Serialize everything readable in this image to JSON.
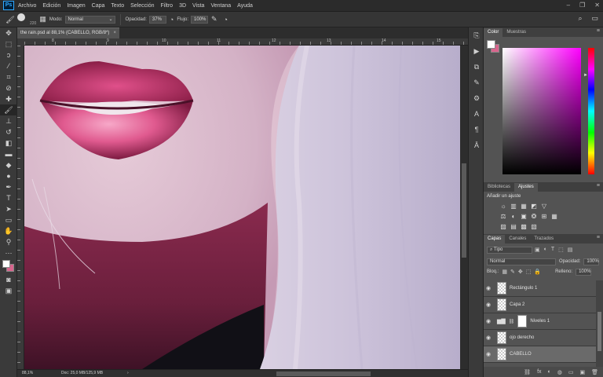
{
  "app": {
    "logo": "Ps"
  },
  "menu": [
    "Archivo",
    "Edición",
    "Imagen",
    "Capa",
    "Texto",
    "Selección",
    "Filtro",
    "3D",
    "Vista",
    "Ventana",
    "Ayuda"
  ],
  "window_controls": [
    "–",
    "❐",
    "✕"
  ],
  "options_bar": {
    "brush_size": "220",
    "mode_label": "Modo:",
    "mode_value": "Normal",
    "opacity_label": "Opacidad:",
    "opacity_value": "37%",
    "flow_label": "Flujo:",
    "flow_value": "100%"
  },
  "document_tab": {
    "title": "the rain.psd al 88,1% (CABELLO, RGB/8*)",
    "close": "×"
  },
  "ruler_labels": [
    "8",
    "9",
    "10",
    "11",
    "12",
    "13",
    "14",
    "15"
  ],
  "status": {
    "zoom": "88,1%",
    "doc": "Doc: 25,0 MB/125,9 MB"
  },
  "color_panel": {
    "tabs": [
      "Color",
      "Muestras"
    ],
    "fg_color": "#ffffff",
    "bg_color": "#d8658d",
    "hue_color": "#ff00ff"
  },
  "adjustments_panel": {
    "tabs": [
      "Bibliotecas",
      "Ajustes"
    ],
    "title": "Añadir un ajuste",
    "row1": [
      "☼",
      "▥",
      "▦",
      "◩",
      "▽"
    ],
    "row2": [
      "⚖",
      "◐",
      "▣",
      "❂",
      "⊞",
      "▦"
    ],
    "row3": [
      "▨",
      "▤",
      "▩",
      "▧"
    ]
  },
  "layers_panel": {
    "tabs": [
      "Capas",
      "Canales",
      "Trazados"
    ],
    "filter_label": "Tipo",
    "blend_mode": "Normal",
    "opacity_label": "Opacidad:",
    "opacity_value": "100%",
    "lock_label": "Bloq.:",
    "fill_label": "Relleno:",
    "fill_value": "100%",
    "layers": [
      {
        "name": "Rectángulo 1",
        "selected": false
      },
      {
        "name": "Capa 2",
        "selected": false
      },
      {
        "name": "Niveles 1",
        "selected": false
      },
      {
        "name": "ojo derecho",
        "selected": false
      },
      {
        "name": "CABELLO",
        "selected": true
      }
    ],
    "footer_icons": [
      "⛓",
      "fx",
      "◐",
      "◍",
      "▭",
      "▣",
      "🗑"
    ]
  }
}
